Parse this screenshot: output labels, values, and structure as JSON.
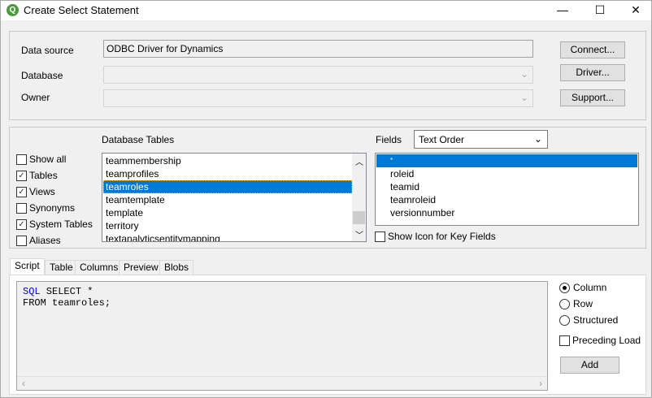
{
  "window": {
    "title": "Create Select Statement",
    "minimize": "—",
    "maximize": "☐",
    "close": "✕",
    "logo": "Q"
  },
  "connection": {
    "data_source_label": "Data source",
    "data_source_value": "ODBC Driver for Dynamics",
    "database_label": "Database",
    "owner_label": "Owner",
    "connect": "Connect...",
    "driver": "Driver...",
    "support": "Support..."
  },
  "filters": [
    {
      "label": "Show all",
      "checked": false
    },
    {
      "label": "Tables",
      "checked": true
    },
    {
      "label": "Views",
      "checked": true
    },
    {
      "label": "Synonyms",
      "checked": false
    },
    {
      "label": "System Tables",
      "checked": true
    },
    {
      "label": "Aliases",
      "checked": false
    }
  ],
  "tables": {
    "label": "Database Tables",
    "items": [
      "teammembership",
      "teamprofiles",
      "teamroles",
      "teamtemplate",
      "template",
      "territory",
      "textanalyticsentitymapping"
    ],
    "selected": "teamroles"
  },
  "fields": {
    "label": "Fields",
    "order": "Text Order",
    "items": [
      "*",
      "roleid",
      "teamid",
      "teamroleid",
      "versionnumber"
    ],
    "selected": "*",
    "show_key_icon": "Show Icon for Key Fields"
  },
  "tabs": [
    "Script",
    "Table",
    "Columns",
    "Preview",
    "Blobs"
  ],
  "script": {
    "keyword": "SQL",
    "line1": " SELECT *",
    "line2": "FROM teamroles;"
  },
  "options": {
    "radios": [
      {
        "label": "Column",
        "checked": true
      },
      {
        "label": "Row",
        "checked": false
      },
      {
        "label": "Structured",
        "checked": false
      }
    ],
    "preceding_load": "Preceding Load",
    "add": "Add"
  }
}
